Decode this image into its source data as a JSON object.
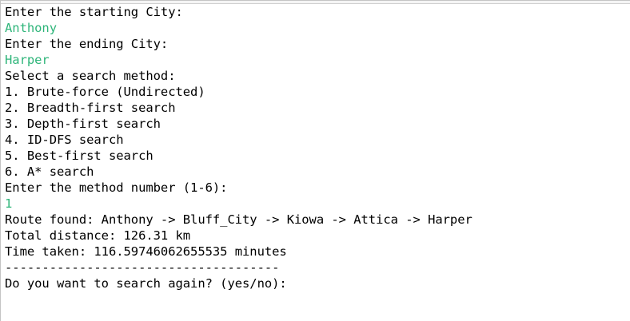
{
  "console": {
    "lines": [
      {
        "text": "Enter the starting City:",
        "kind": "output"
      },
      {
        "text": "Anthony",
        "kind": "input"
      },
      {
        "text": "Enter the ending City:",
        "kind": "output"
      },
      {
        "text": "Harper",
        "kind": "input"
      },
      {
        "text": "Select a search method:",
        "kind": "output"
      },
      {
        "text": "1. Brute-force (Undirected)",
        "kind": "output"
      },
      {
        "text": "2. Breadth-first search",
        "kind": "output"
      },
      {
        "text": "3. Depth-first search",
        "kind": "output"
      },
      {
        "text": "4. ID-DFS search",
        "kind": "output"
      },
      {
        "text": "5. Best-first search",
        "kind": "output"
      },
      {
        "text": "6. A* search",
        "kind": "output"
      },
      {
        "text": "Enter the method number (1-6):",
        "kind": "output"
      },
      {
        "text": "1",
        "kind": "input"
      },
      {
        "text": "Route found: Anthony -> Bluff_City -> Kiowa -> Attica -> Harper",
        "kind": "output"
      },
      {
        "text": "Total distance: 126.31 km",
        "kind": "output"
      },
      {
        "text": "Time taken: 116.59746062655535 minutes",
        "kind": "output"
      },
      {
        "text": "-------------------------------------",
        "kind": "output"
      },
      {
        "text": "Do you want to search again? (yes/no):",
        "kind": "output"
      }
    ]
  },
  "colors": {
    "output_text": "#000000",
    "input_text": "#2fb57a",
    "background": "#ffffff"
  }
}
